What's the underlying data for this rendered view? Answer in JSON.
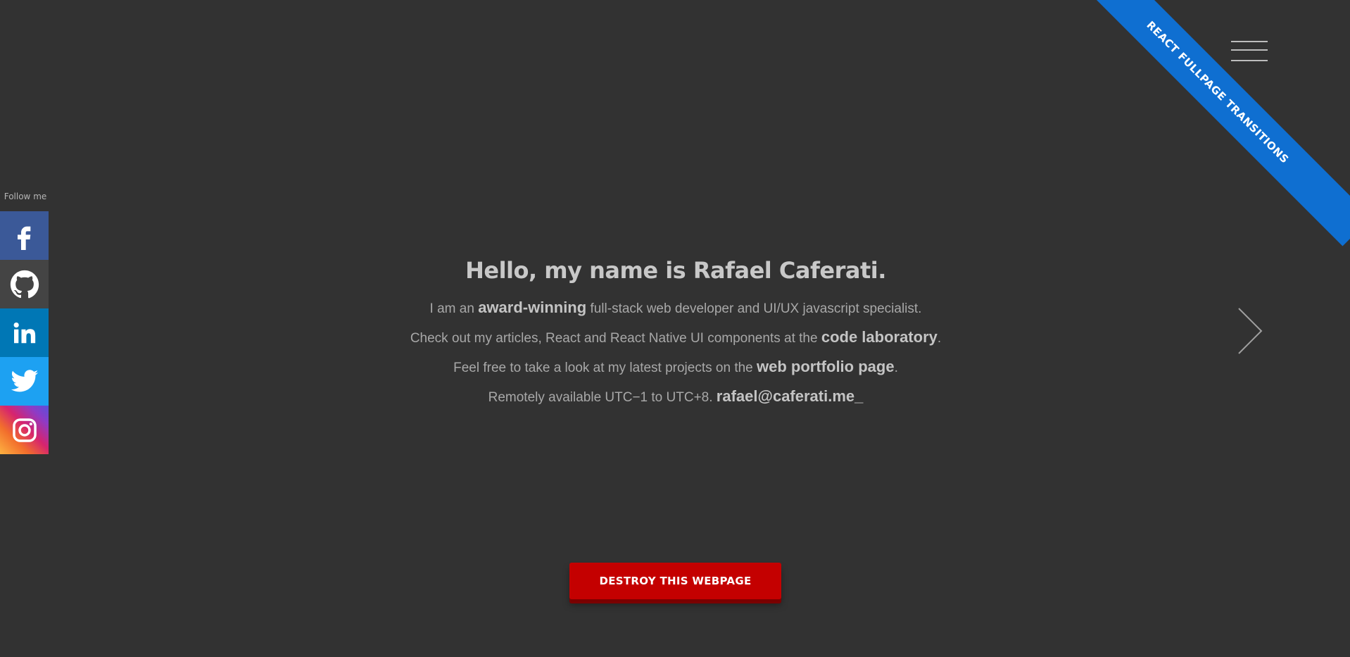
{
  "ribbon": {
    "label": "REACT FULLPAGE TRANSITIONS",
    "color": "#0f6fd1"
  },
  "menu": {
    "icon": "hamburger-menu-icon"
  },
  "navigation": {
    "next_icon": "chevron-right-icon"
  },
  "social": {
    "label": "Follow me",
    "items": [
      {
        "name": "facebook",
        "icon": "facebook-icon",
        "color": "#3b5998"
      },
      {
        "name": "github",
        "icon": "github-icon",
        "color": "#444444"
      },
      {
        "name": "linkedin",
        "icon": "linkedin-icon",
        "color": "#0077b5"
      },
      {
        "name": "twitter",
        "icon": "twitter-icon",
        "color": "#1da1f2"
      },
      {
        "name": "instagram",
        "icon": "instagram-icon",
        "color": "#d6246e"
      }
    ]
  },
  "hero": {
    "title": "Hello, my name is Rafael Caferati.",
    "line1": {
      "before": "I am an ",
      "bold": "award-winning",
      "after": " full-stack web developer and UI/UX javascript specialist."
    },
    "line2": {
      "before": "Check out my articles, React and React Native UI components at the ",
      "link": "code laboratory",
      "after": "."
    },
    "line3": {
      "before": "Feel free to take a look at my latest projects on the ",
      "link": "web portfolio page",
      "after": "."
    },
    "line4": {
      "before": "Remotely available UTC−1 to UTC+8. ",
      "link": "rafael@caferati.me",
      "cursor": "_"
    }
  },
  "actions": {
    "destroy_label": "DESTROY THIS WEBPAGE",
    "destroy_color": "#c40000"
  },
  "colors": {
    "background": "#323232"
  }
}
